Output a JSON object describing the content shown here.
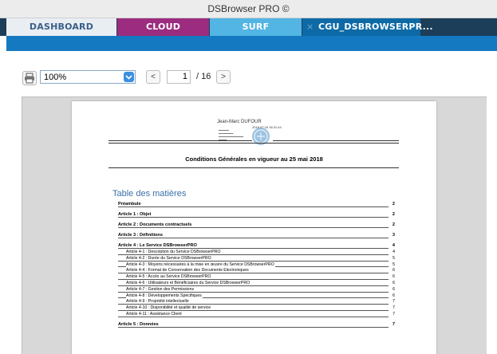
{
  "window": {
    "title": "DSBrowser PRO ©"
  },
  "tabs": [
    {
      "label": "DASHBOARD"
    },
    {
      "label": "CLOUD"
    },
    {
      "label": "SURF"
    },
    {
      "label": "CGU_DSBROWSERPR...",
      "close": "×"
    }
  ],
  "toolbar": {
    "zoom_value": "100%",
    "prev_label": "<",
    "page_current": "1",
    "page_total": "/ 16",
    "next_label": ">"
  },
  "document": {
    "signer_name": "Jean-Marc DUFOUR",
    "sign_date": "2018.07.18 18:21:44",
    "title": "Conditions Générales en vigueur au 25 mai 2018",
    "toc_title": "Table des matières",
    "toc": [
      {
        "label": "Préambule",
        "page": "2",
        "level": "main"
      },
      {
        "label": "Article 1 : Objet",
        "page": "2",
        "level": "main"
      },
      {
        "label": "Article 2 : Documents contractuels",
        "page": "2",
        "level": "main"
      },
      {
        "label": "Article 3 : Définitions",
        "page": "3",
        "level": "main"
      },
      {
        "label": "Article 4 : Le Service DSBrowserPRO",
        "page": "4",
        "level": "main"
      },
      {
        "label": "Article 4-1 : Description du Service DSBrowserPRO",
        "page": "4",
        "level": "sub"
      },
      {
        "label": "Article 4-2 : Durée du Service DSBrowserPRO",
        "page": "5",
        "level": "sub"
      },
      {
        "label": "Article 4-3 : Moyens nécessaires à la mise en œuvre du Service DSBrowserPRO",
        "page": "5",
        "level": "sub"
      },
      {
        "label": "Article 4-4 : Format de Conservation des Documents Electroniques",
        "page": "6",
        "level": "sub"
      },
      {
        "label": "Article 4-5 : Accès au Service DSBrowserPRO",
        "page": "6",
        "level": "sub"
      },
      {
        "label": "Article 4-6 : Utilisateurs et Bénéficiaires du Service DSBrowserPRO",
        "page": "6",
        "level": "sub"
      },
      {
        "label": "Article 4-7 : Gestion des Permissions",
        "page": "6",
        "level": "sub"
      },
      {
        "label": "Article 4-8 : Développements Spécifiques",
        "page": "6",
        "level": "sub"
      },
      {
        "label": "Article 4-9 : Propriété intellectuelle",
        "page": "7",
        "level": "sub"
      },
      {
        "label": "Article 4-10 : Disponibilité et qualité de service",
        "page": "7",
        "level": "sub"
      },
      {
        "label": "Article 4-11 : Assistance Client",
        "page": "7",
        "level": "sub"
      },
      {
        "label": "Article 5 : Données",
        "page": "7",
        "level": "main"
      }
    ]
  },
  "colors": {
    "tab_dashboard": "#e9eef3",
    "tab_cloud": "#9b2c7f",
    "tab_surf": "#52b5e3",
    "tab_doc": "#0e6aa6",
    "band": "#1479c1"
  }
}
